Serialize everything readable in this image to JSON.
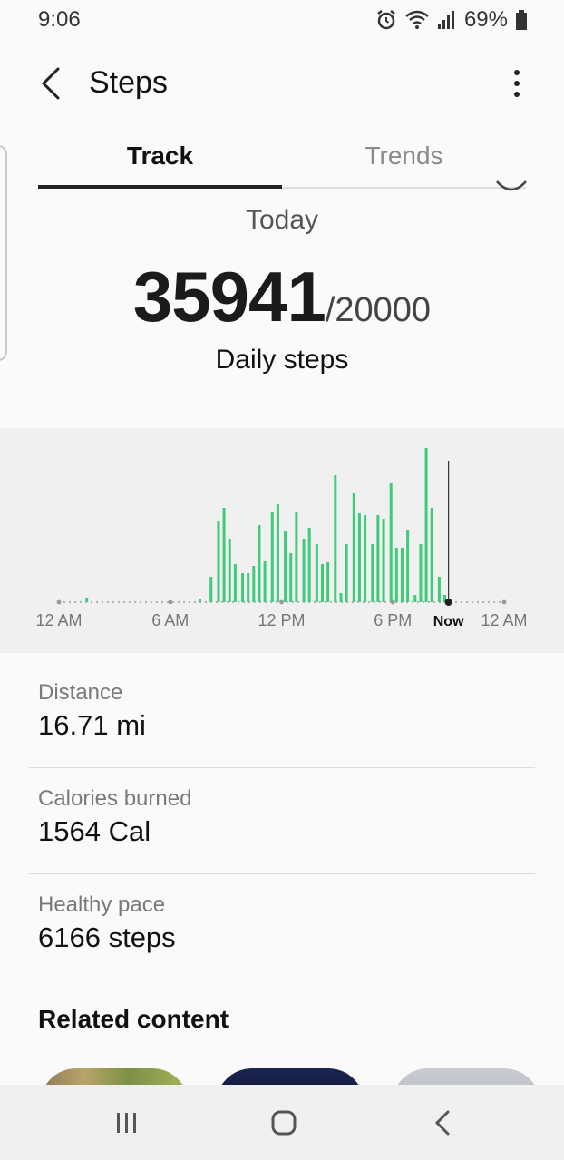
{
  "status_bar": {
    "time": "9:06",
    "battery": "69%"
  },
  "header": {
    "title": "Steps"
  },
  "tabs": [
    {
      "label": "Track"
    },
    {
      "label": "Trends"
    }
  ],
  "summary": {
    "period": "Today",
    "steps": "35941",
    "goal": "/20000",
    "label": "Daily steps"
  },
  "chart_data": {
    "type": "bar",
    "x_tick_labels": [
      "12 AM",
      "6 AM",
      "12 PM",
      "6 PM",
      "Now",
      "12 AM"
    ],
    "x_domain_hours": [
      0,
      24
    ],
    "now_hour": 21,
    "bar_hours": [
      1.5,
      7.6,
      8.2,
      8.6,
      8.9,
      9.2,
      9.5,
      9.9,
      10.2,
      10.5,
      10.8,
      11.1,
      11.5,
      11.8,
      12.2,
      12.5,
      12.8,
      13.2,
      13.5,
      13.9,
      14.2,
      14.5,
      14.9,
      15.2,
      15.5,
      15.9,
      16.2,
      16.5,
      16.9,
      17.2,
      17.5,
      17.9,
      18.2,
      18.5,
      18.8,
      19.2,
      19.5,
      19.8,
      20.1,
      20.5,
      20.8
    ],
    "values": [
      5,
      3,
      28,
      90,
      104,
      70,
      42,
      32,
      32,
      40,
      85,
      45,
      100,
      108,
      78,
      54,
      100,
      70,
      82,
      64,
      42,
      44,
      140,
      10,
      64,
      120,
      98,
      96,
      64,
      96,
      92,
      132,
      60,
      60,
      80,
      8,
      64,
      170,
      104,
      28,
      8
    ],
    "ylim": [
      0,
      180
    ],
    "color": "#3ecb7a"
  },
  "metrics": [
    {
      "label": "Distance",
      "value": "16.71 mi"
    },
    {
      "label": "Calories burned",
      "value": "1564 Cal"
    },
    {
      "label": "Healthy pace",
      "value": "6166 steps"
    }
  ],
  "related": {
    "title": "Related content"
  },
  "icons": {
    "back": "back-arrow-icon",
    "more": "more-vert-icon",
    "alarm": "alarm-icon",
    "wifi": "wifi-icon",
    "signal": "signal-icon",
    "battery": "battery-icon",
    "nav_recents": "recents-icon",
    "nav_home": "home-icon",
    "nav_back": "nav-back-icon"
  }
}
